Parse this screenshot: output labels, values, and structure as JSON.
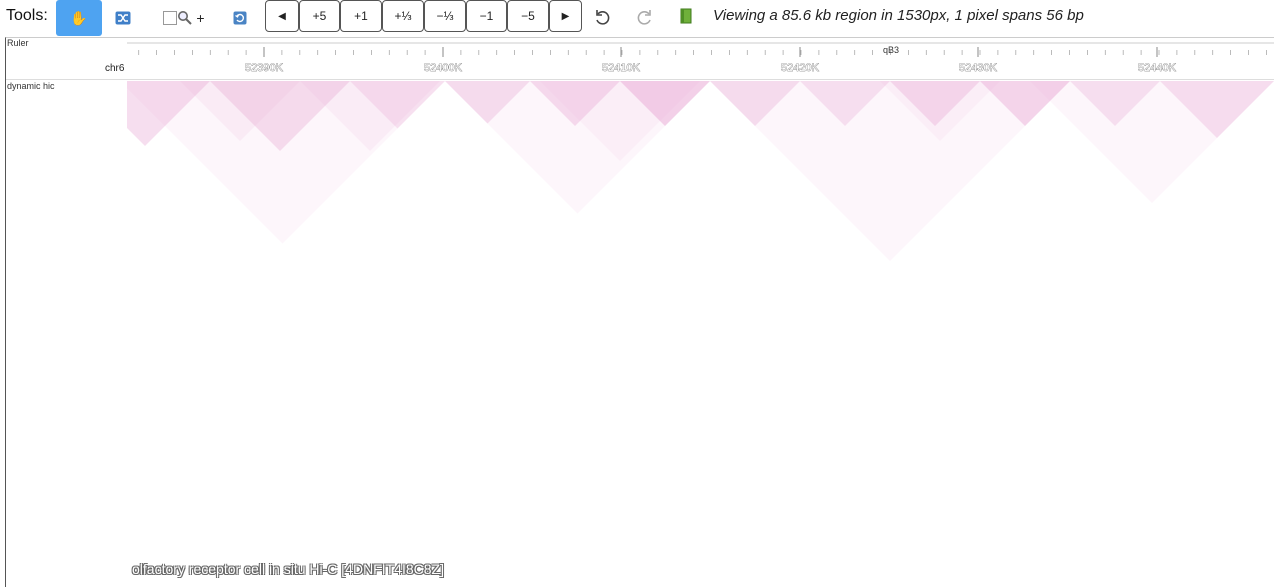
{
  "toolbar": {
    "tools_label": "Tools:",
    "tools": [
      {
        "name": "pan-tool",
        "icon": "hand-icon",
        "active": true
      },
      {
        "name": "shuffle-tool",
        "icon": "shuffle-icon",
        "active": false
      },
      {
        "name": "zoom-box-tool",
        "icon": "magnifier-icon",
        "plus": "+",
        "active": false
      },
      {
        "name": "reset-tool",
        "icon": "refresh-icon",
        "active": false
      }
    ],
    "nav_buttons": [
      {
        "name": "move-left-button",
        "label": "◀"
      },
      {
        "name": "zoom-in-5-button",
        "label": "+5"
      },
      {
        "name": "zoom-in-1-button",
        "label": "+1"
      },
      {
        "name": "zoom-in-third-button",
        "label": "+⅓"
      },
      {
        "name": "zoom-out-third-button",
        "label": "−⅓"
      },
      {
        "name": "zoom-out-1-button",
        "label": "−1"
      },
      {
        "name": "zoom-out-5-button",
        "label": "−5"
      },
      {
        "name": "move-right-button",
        "label": "▶"
      }
    ],
    "undo_icon": "undo-icon",
    "redo_icon": "redo-icon",
    "book_icon": "book-icon",
    "status_text": "Viewing a 85.6 kb region in 1530px, 1 pixel spans 56 bp",
    "accent_color": "#4ea3f1"
  },
  "tracks": {
    "ruler_label": "Ruler",
    "chromosome": "chr6",
    "band_label": "qB3",
    "ticks": [
      "52390K",
      "52400K",
      "52410K",
      "52420K",
      "52430K",
      "52440K"
    ],
    "hic_label": "dynamic hic",
    "sample_label": "olfactory receptor cell in situ Hi-C [4DNFIT4I8C8Z]",
    "hic_color": "#e8a8d4"
  }
}
